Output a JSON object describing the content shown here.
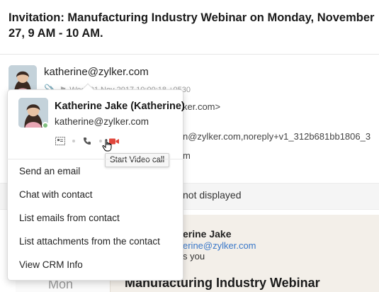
{
  "email": {
    "subject": "Invitation: Manufacturing Industry Webinar on Monday, November 27, 9 AM - 10 AM.",
    "sender_email": "katherine@zylker.com",
    "date": "Wed, 01 Nov 2017 10:00:18 +0530",
    "to_fragment": "ker.com>",
    "cc_fragment": "n@zylker.com,noreply+v1_312b681bb1806_3",
    "to2_fragment": "m",
    "notice": "not displayed"
  },
  "invite": {
    "organizer_name": "erine Jake",
    "organizer_email": "erine@zylker.com",
    "sub": "s you",
    "title": "Manufacturing Industry Webinar",
    "day": "Mon"
  },
  "contact_popup": {
    "name": "Katherine Jake (Katherine)",
    "email": "katherine@zylker.com",
    "status_color": "#7fbf7f",
    "icons": [
      "contact-card-icon",
      "phone-icon",
      "video-call-icon"
    ],
    "menu": [
      "Send an email",
      "Chat with contact",
      "List emails from contact",
      "List attachments from the contact",
      "View CRM Info"
    ]
  },
  "tooltip": "Start Video call",
  "colors": {
    "accent_link": "#3a78c9",
    "video_icon": "#e0463b"
  }
}
